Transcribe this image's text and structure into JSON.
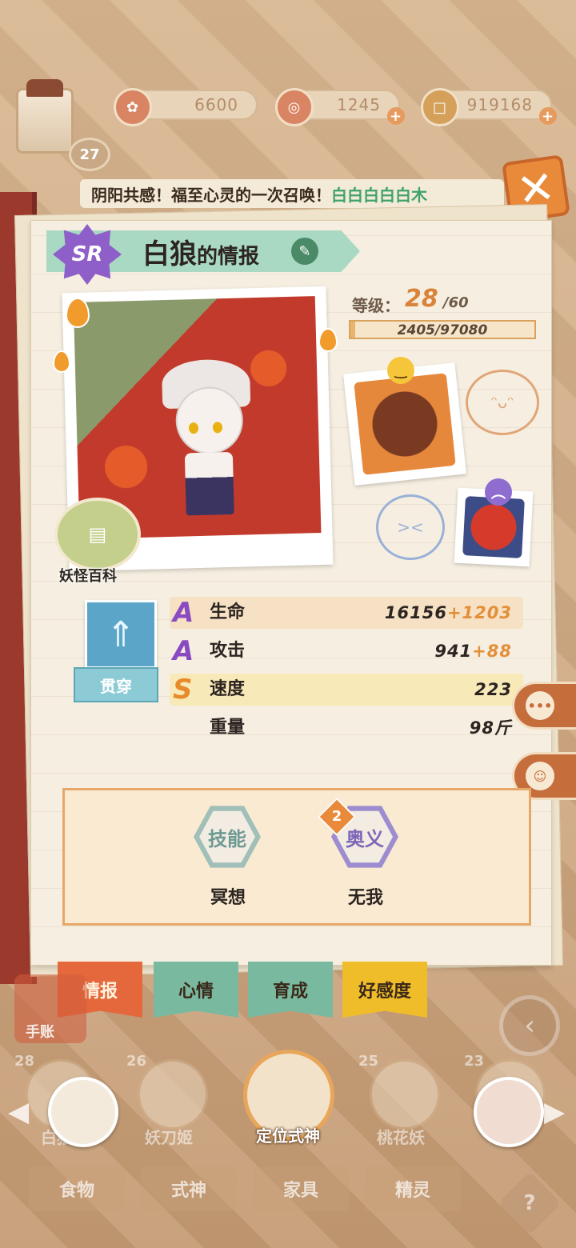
{
  "top_bar": {
    "player_level": "27",
    "resources": [
      {
        "icon": "plum-flower-icon",
        "value": "6600"
      },
      {
        "icon": "spirit-jade-icon",
        "value": "1245"
      },
      {
        "icon": "coin-icon",
        "value": "919168"
      }
    ]
  },
  "marquee": {
    "text": "阴阳共感！福至心灵的一次召唤！",
    "highlight": "白白白白白木"
  },
  "profile": {
    "rarity": "SR",
    "name": "白狼",
    "title_suffix": "的情报",
    "level_label": "等级：",
    "level": "28",
    "level_max": "/60",
    "exp_text": "2405/97080",
    "exp_fraction": 0.025,
    "encyclopedia_label": "妖怪百科"
  },
  "stats": {
    "skill_label": "贯穿",
    "rows": [
      {
        "grade": "A",
        "name": "生命",
        "base": "16156",
        "bonus": "+1203"
      },
      {
        "grade": "A",
        "name": "攻击",
        "base": "941",
        "bonus": "+88"
      },
      {
        "grade": "S",
        "name": "速度",
        "base": "223",
        "bonus": ""
      },
      {
        "grade": "",
        "name": "重量",
        "base": "98斤",
        "bonus": ""
      }
    ]
  },
  "skills": [
    {
      "type": "技能",
      "name": "冥想",
      "badge": ""
    },
    {
      "type": "奥义",
      "name": "无我",
      "badge": "2"
    }
  ],
  "tabs": [
    "情报",
    "心情",
    "育成",
    "好感度"
  ],
  "shoukan_label": "手账",
  "roster": {
    "locate_label": "定位式神",
    "items": [
      {
        "level": "28",
        "name": "白狼"
      },
      {
        "level": "26",
        "name": "妖刀姬"
      },
      {
        "level": "25",
        "name": "桃花妖"
      },
      {
        "level": "23",
        "name": ""
      }
    ]
  },
  "bottom_tabs": [
    "食物",
    "式神",
    "家具",
    "精灵"
  ],
  "colors": {
    "accent": "#e88a3a",
    "title_ribbon": "#a9d9c3",
    "rarity": "#8f5fc9"
  }
}
